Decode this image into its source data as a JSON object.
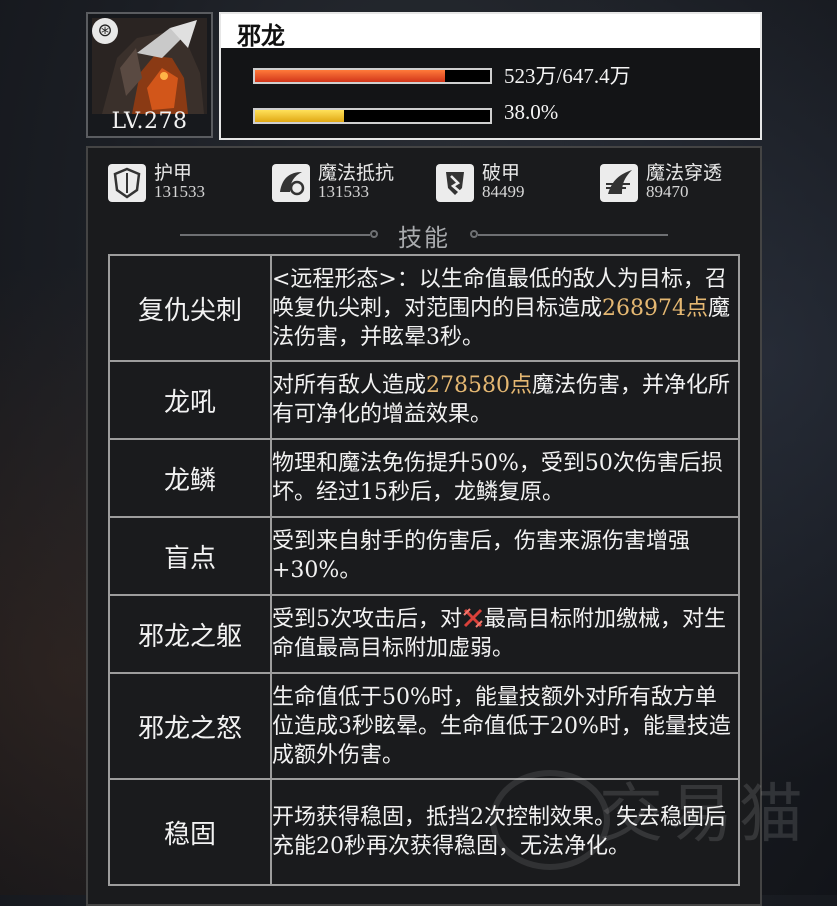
{
  "boss": {
    "name": "邪龙",
    "level": "LV.278",
    "hp_text": "523万/647.4万",
    "hp_fraction": 0.808,
    "energy_text": "38.0%",
    "energy_fraction": 0.38
  },
  "stats": [
    {
      "label": "护甲",
      "value": "131533",
      "icon": "armor-shield-icon"
    },
    {
      "label": "魔法抵抗",
      "value": "131533",
      "icon": "magic-resist-icon"
    },
    {
      "label": "破甲",
      "value": "84499",
      "icon": "armor-break-icon"
    },
    {
      "label": "魔法穿透",
      "value": "89470",
      "icon": "magic-penetration-icon"
    }
  ],
  "section_title": "技能",
  "skills": [
    {
      "name": "复仇尖刺",
      "pre": "<远程形态>：以生命值最低的敌人为目标，召唤复仇尖刺，对范围内的目标造成",
      "highlight": "268974点",
      "post": "魔法伤害，并眩晕3秒。"
    },
    {
      "name": "龙吼",
      "pre": "对所有敌人造成",
      "highlight": "278580点",
      "post": "魔法伤害，并净化所有可净化的增益效果。"
    },
    {
      "name": "龙鳞",
      "pre": "物理和魔法免伤提升50%，受到50次伤害后损坏。经过15秒后，龙鳞复原。",
      "highlight": "",
      "post": ""
    },
    {
      "name": "盲点",
      "pre": "受到来自射手的伤害后，伤害来源伤害增强+30%。",
      "highlight": "",
      "post": ""
    },
    {
      "name": "邪龙之躯",
      "pre": "受到5次攻击后，对",
      "highlight": "",
      "post": "最高目标附加缴械，对生命值最高目标附加虚弱。"
    },
    {
      "name": "邪龙之怒",
      "pre": "生命值低于50%时，能量技额外对所有敌方单位造成3秒眩晕。生命值低于20%时，能量技造成额外伤害。",
      "highlight": "",
      "post": ""
    },
    {
      "name": "稳固",
      "pre": "开场获得稳固，抵挡2次控制效果。失去稳固后充能20秒再次获得稳固，无法净化。",
      "highlight": "",
      "post": ""
    }
  ],
  "watermark": "交易猫",
  "colors": {
    "highlight": "#e5b872",
    "hp": "#e0481f",
    "energy": "#f2c12e"
  }
}
